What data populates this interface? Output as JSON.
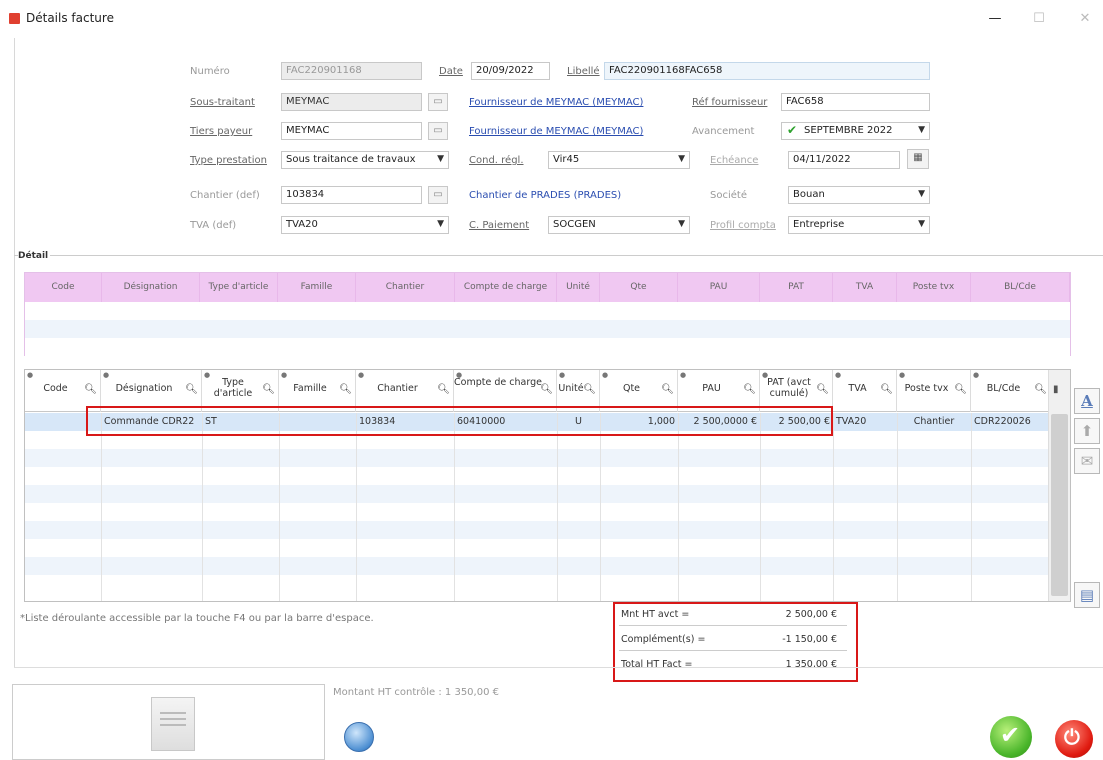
{
  "window": {
    "title": "Détails facture",
    "minimize": "—",
    "maximize": "☐",
    "close": "✕"
  },
  "form": {
    "numero": {
      "label": "Numéro",
      "value": "FAC220901168"
    },
    "date": {
      "label": "Date",
      "value": "20/09/2022"
    },
    "libelle": {
      "label": "Libellé",
      "value": "FAC220901168FAC658"
    },
    "sous_traitant": {
      "label": "Sous-traitant",
      "value": "MEYMAC",
      "link": "Fournisseur de MEYMAC (MEYMAC)"
    },
    "ref_fournisseur": {
      "label": "Réf fournisseur",
      "value": "FAC658"
    },
    "tiers_payeur": {
      "label": "Tiers payeur",
      "value": "MEYMAC",
      "link": "Fournisseur de MEYMAC (MEYMAC)"
    },
    "avancement": {
      "label": "Avancement",
      "value": "SEPTEMBRE 2022"
    },
    "type_prestation": {
      "label": "Type prestation",
      "value": "Sous traitance de travaux"
    },
    "cond_regl": {
      "label": "Cond. régl.",
      "value": "Vir45"
    },
    "echeance": {
      "label": "Echéance",
      "value": "04/11/2022"
    },
    "chantier": {
      "label": "Chantier (def)",
      "value": "103834",
      "link": "Chantier de PRADES (PRADES)"
    },
    "societe": {
      "label": "Société",
      "value": "Bouan"
    },
    "tva": {
      "label": "TVA (def)",
      "value": "TVA20"
    },
    "c_paiement": {
      "label": "C. Paiement",
      "value": "SOCGEN"
    },
    "profil_compta": {
      "label": "Profil compta",
      "value": "Entreprise"
    }
  },
  "detail_caption": "Détail",
  "pink_headers": [
    "Code",
    "Désignation",
    "Type d'article",
    "Famille",
    "Chantier",
    "Compte de charge",
    "Unité",
    "Qte",
    "PAU",
    "PAT",
    "TVA",
    "Poste tvx",
    "BL/Cde"
  ],
  "grid_headers": [
    "Code",
    "Désignation",
    "Type d'article",
    "Famille",
    "Chantier",
    "Compte de charge",
    "Unité",
    "Qte",
    "PAU",
    "PAT (avct cumulé)",
    "TVA",
    "Poste tvx",
    "BL/Cde"
  ],
  "grid_rows": [
    {
      "code": "",
      "designation": "Commande CDR22",
      "type": "ST",
      "famille": "",
      "chantier": "103834",
      "compte": "60410000",
      "unite": "U",
      "qte": "1,000",
      "pau": "2 500,0000 €",
      "pat": "2 500,00 €",
      "tva": "TVA20",
      "poste": "Chantier",
      "blcde": "CDR220026"
    }
  ],
  "footnote": "*Liste déroulante accessible par la touche F4 ou par la barre d'espace.",
  "totals": {
    "mnt_label": "Mnt HT avct =",
    "mnt_value": "2 500,00 €",
    "compl_label": "Complément(s) =",
    "compl_value": "-1 150,00 €",
    "total_label": "Total HT Fact =",
    "total_value": "1 350,00 €"
  },
  "controle": "Montant HT contrôle : 1 350,00 €",
  "side_buttons": {
    "a": "A"
  }
}
